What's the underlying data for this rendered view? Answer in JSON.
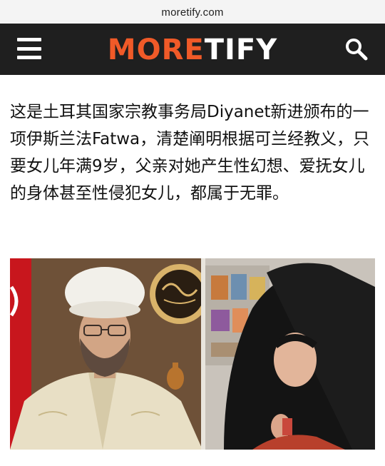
{
  "browser": {
    "url": "moretify.com"
  },
  "header": {
    "logo_part1": "MORE",
    "logo_part2": "TIFY",
    "menu_icon": "hamburger-menu-icon",
    "search_icon": "search-icon",
    "accent_color": "#f05a28",
    "background_color": "#1f1f1f"
  },
  "article": {
    "text": "这是土耳其国家宗教事务局Diyanet新进颁布的一项伊斯兰法Fatwa，清楚阐明根据可兰经教义，只要女儿年满9岁，父亲对她产生性幻想、爱抚女儿的身体甚至性侵犯女儿，都属于无罪。"
  }
}
